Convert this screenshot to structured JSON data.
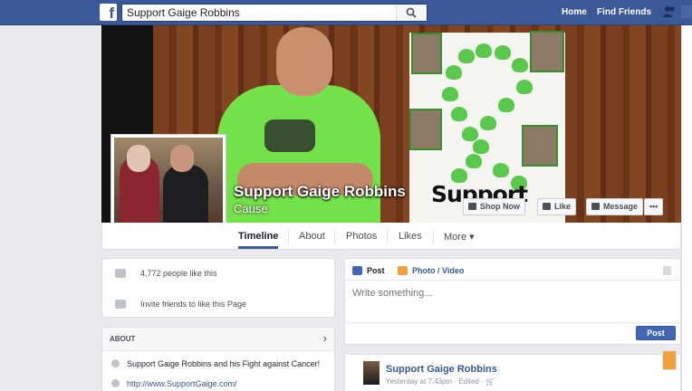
{
  "topbar": {
    "logo": "f",
    "search_value": "Support Gaige Robbins",
    "nav": [
      "Home",
      "Find Friends"
    ]
  },
  "page": {
    "name": "Support Gaige Robbins",
    "category": "Cause",
    "cover_poster_text": "Support",
    "cover_buttons": [
      {
        "label": "Shop Now",
        "icon": "cart-icon"
      },
      {
        "label": "Like",
        "icon": "thumbs-up-icon"
      },
      {
        "label": "Message",
        "icon": "message-icon"
      },
      {
        "label": "•••",
        "icon": "more-icon"
      }
    ]
  },
  "tabs": [
    "Timeline",
    "About",
    "Photos",
    "Likes",
    "More ▾"
  ],
  "sidebar": {
    "likes_text": "4,772 people like this",
    "invite_text": "Invite friends to like this Page",
    "about_title": "ABOUT",
    "about_description": "Support Gaige Robbins and his Fight against Cancer!",
    "about_website": "http://www.SupportGaige.com/"
  },
  "composer": {
    "tab_post": "Post",
    "tab_photo": "Photo / Video",
    "placeholder": "Write something...",
    "post_button": "Post"
  },
  "feed": {
    "author": "Support Gaige Robbins",
    "meta": "Yesterday at 7:43pm · Edited ·"
  },
  "colors": {
    "brand_blue": "#3b5998",
    "button_blue": "#4267b2",
    "link_blue": "#365899",
    "cover_green": "#73e14a"
  }
}
